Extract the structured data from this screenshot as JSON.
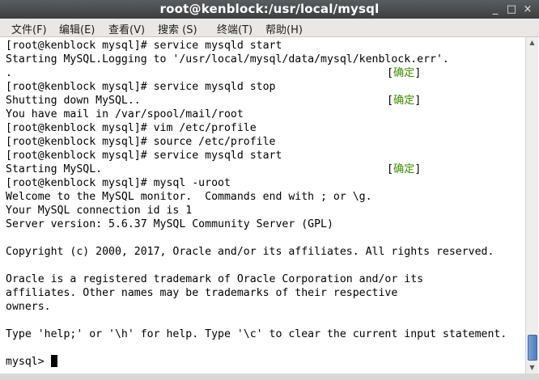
{
  "window": {
    "title": "root@kenblock:/usr/local/mysql",
    "minimize_glyph": "_",
    "maximize_glyph": "□",
    "close_glyph": "×"
  },
  "menu": [
    "文件(F)",
    "编辑(E)",
    "查看(V)",
    "搜索 (S)",
    "终端(T)",
    "帮助(H)"
  ],
  "terminal": {
    "lines": [
      "[root@kenblock mysql]# service mysqld start",
      "Starting MySQL.Logging to '/usr/local/mysql/data/mysql/kenblock.err'.",
      ".",
      "[root@kenblock mysql]# service mysqld stop",
      "Shutting down MySQL..",
      "You have mail in /var/spool/mail/root",
      "[root@kenblock mysql]# vim /etc/profile",
      "[root@kenblock mysql]# source /etc/profile",
      "[root@kenblock mysql]# service mysqld start",
      "Starting MySQL.",
      "[root@kenblock mysql]# mysql -uroot",
      "Welcome to the MySQL monitor.  Commands end with ; or \\g.",
      "Your MySQL connection id is 1",
      "Server version: 5.6.37 MySQL Community Server (GPL)",
      "",
      "Copyright (c) 2000, 2017, Oracle and/or its affiliates. All rights reserved.",
      "",
      "Oracle is a registered trademark of Oracle Corporation and/or its",
      "affiliates. Other names may be trademarks of their respective",
      "owners.",
      "",
      "Type 'help;' or '\\h' for help. Type '\\c' to clear the current input statement.",
      "",
      "mysql> "
    ],
    "status_ok": "确定",
    "status_bracket_open": "[",
    "status_bracket_close": "]",
    "status_lines": [
      2,
      4,
      9
    ],
    "text_color": "#000000",
    "ok_color": "#3e8e00"
  }
}
